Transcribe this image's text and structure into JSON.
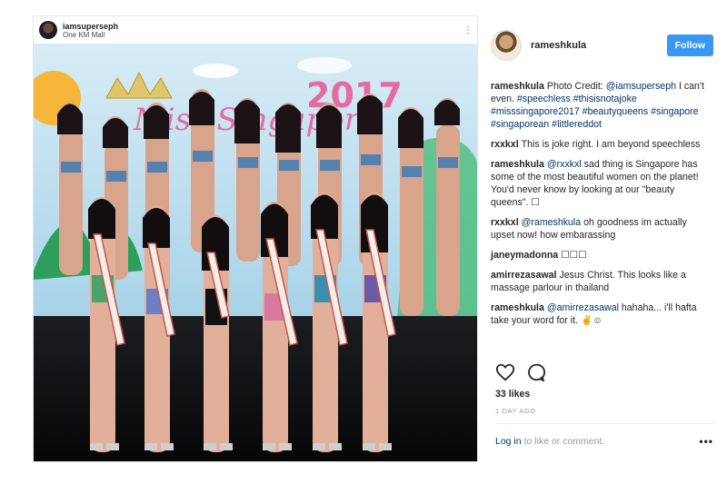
{
  "photo_header": {
    "username": "iamsuperseph",
    "location": "One KM Mall",
    "more": "⋮"
  },
  "photo": {
    "banner_year": "2017",
    "banner_text": "Miss Singapore",
    "colors": {
      "banner": "#cfe7f2",
      "stage": "#0e0f11",
      "accent": "#e66aa0"
    }
  },
  "sidebar": {
    "username": "rameshkula",
    "follow_label": "Follow",
    "comments": [
      {
        "user": "rameshkula",
        "text": "Photo Credit: @iamsuperseph I can't even. #speechless #thisisnotajoke #misssingapore2017 #beautyqueens #singapore #singaporean #littlereddot"
      },
      {
        "user": "rxxkxl",
        "text": "This is joke right. I am beyond speechless"
      },
      {
        "user": "rameshkula",
        "text": "@rxxkxl sad thing is Singapore has some of the most beautiful women on the planet! You'd never know by looking at our \"beauty queens\". ☐"
      },
      {
        "user": "rxxkxl",
        "text": "@rameshkula oh goodness im actually upset now! how embarassing"
      },
      {
        "user": "janeymadonna",
        "text": "☐☐☐"
      },
      {
        "user": "amirrezasawal",
        "text": "Jesus Christ. This looks like a massage parlour in thailand"
      },
      {
        "user": "rameshkula",
        "text": "@amirrezasawal hahaha... i'll hafta take your word for it. ✌☺"
      }
    ]
  },
  "actions": {
    "like_icon": "heart-icon",
    "comment_icon": "comment-icon"
  },
  "likes": "33 likes",
  "time": "1 DAY AGO",
  "login": {
    "link": "Log in",
    "rest": "to like or comment.",
    "more": "•••"
  }
}
